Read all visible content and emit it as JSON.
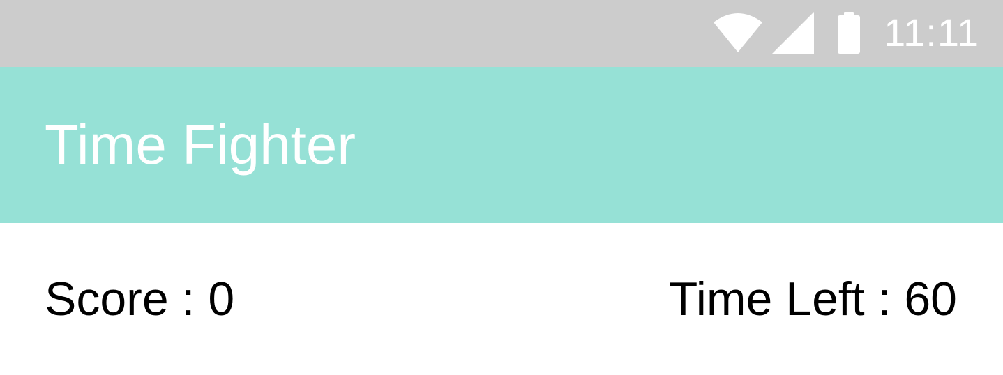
{
  "status_bar": {
    "time": "11:11",
    "icons": [
      "wifi-icon",
      "cellular-signal-icon",
      "battery-icon"
    ],
    "background_color": "#cccccc"
  },
  "app_bar": {
    "title": "Time Fighter",
    "background_color": "#96e1d6"
  },
  "game": {
    "score_text": "Score : 0",
    "time_left_text": "Time Left : 60"
  }
}
